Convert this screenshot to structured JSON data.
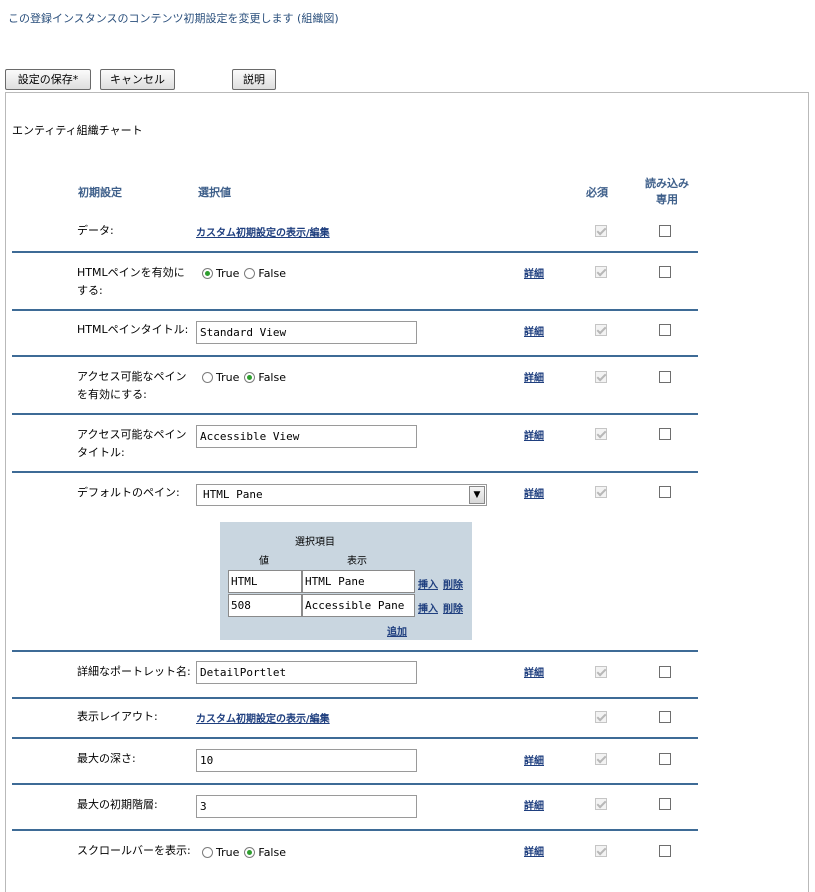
{
  "page": {
    "title": "この登録インスタンスのコンテンツ初期設定を変更します (組織図)"
  },
  "toolbar": {
    "save_label": "設定の保存*",
    "cancel_label": "キャンセル",
    "help_label": "説明"
  },
  "section": {
    "title": "エンティティ組織チャート"
  },
  "headers": {
    "setting": "初期設定",
    "value": "選択値",
    "required": "必須",
    "readonly": "読み込み 専用"
  },
  "detail_label": "詳細",
  "rows": {
    "data": {
      "label": "データ:",
      "link": "カスタム初期設定の表示/編集"
    },
    "html_enable": {
      "label": "HTMLペインを有効にする:",
      "true_label": "True",
      "false_label": "False",
      "selected": "True"
    },
    "html_title": {
      "label": "HTMLペインタイトル:",
      "value": "Standard View"
    },
    "access_enable": {
      "label": "アクセス可能なペインを有効にする:",
      "true_label": "True",
      "false_label": "False",
      "selected": "False"
    },
    "access_title": {
      "label": "アクセス可能なペインタイトル:",
      "value": "Accessible View"
    },
    "default_pane": {
      "label": "デフォルトのペイン:",
      "value": "HTML Pane"
    },
    "detail_portlet": {
      "label": "詳細なポートレット名:",
      "value": "DetailPortlet"
    },
    "layout": {
      "label": "表示レイアウト:",
      "link": "カスタム初期設定の表示/編集"
    },
    "max_depth": {
      "label": "最大の深さ:",
      "value": "10"
    },
    "max_levels": {
      "label": "最大の初期階層:",
      "value": "3"
    },
    "scrollbar": {
      "label": "スクロールバーを表示:",
      "true_label": "True",
      "false_label": "False",
      "selected": "False"
    }
  },
  "options_table": {
    "title": "選択項目",
    "col_value": "値",
    "col_display": "表示",
    "insert_label": "挿入",
    "delete_label": "削除",
    "add_label": "追加",
    "rows": [
      {
        "value": "HTML",
        "display": "HTML Pane"
      },
      {
        "value": "508",
        "display": "Accessible Pane"
      }
    ]
  }
}
